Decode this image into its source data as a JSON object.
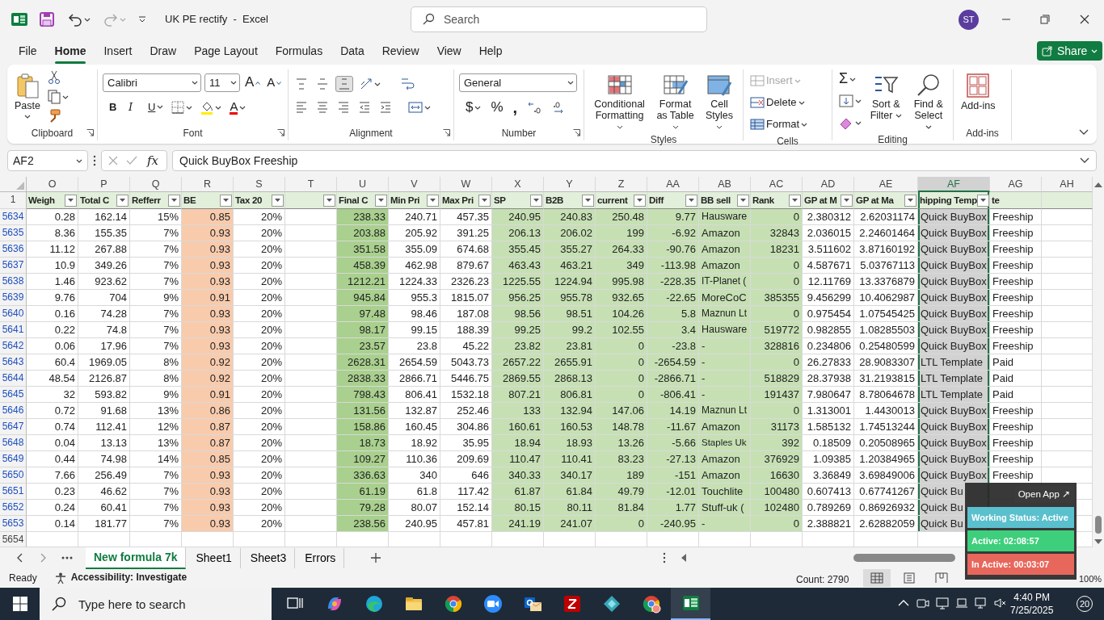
{
  "window": {
    "title": "UK PE rectify  -  Excel",
    "search_placeholder": "Search",
    "avatar": "ST"
  },
  "menu": [
    {
      "label": "File",
      "selected": false
    },
    {
      "label": "Home",
      "selected": true
    },
    {
      "label": "Insert",
      "selected": false
    },
    {
      "label": "Draw",
      "selected": false
    },
    {
      "label": "Page Layout",
      "selected": false
    },
    {
      "label": "Formulas",
      "selected": false
    },
    {
      "label": "Data",
      "selected": false
    },
    {
      "label": "Review",
      "selected": false
    },
    {
      "label": "View",
      "selected": false
    },
    {
      "label": "Help",
      "selected": false
    }
  ],
  "share": "Share",
  "ribbon": {
    "clipboard": {
      "label": "Clipboard",
      "paste": "Paste"
    },
    "font": {
      "label": "Font",
      "face": "Calibri",
      "size": "11",
      "grow": "A",
      "shrink": "A",
      "bold": "B",
      "italic": "I",
      "underline": "U",
      "color_button": "A"
    },
    "alignment": {
      "label": "Alignment",
      "vertical": [
        {
          "kind": "top",
          "selected": false
        },
        {
          "kind": "middle",
          "selected": false
        },
        {
          "kind": "bottom",
          "selected": true
        }
      ],
      "horizontal": [
        {
          "kind": "left",
          "selected": false
        },
        {
          "kind": "center",
          "selected": false
        },
        {
          "kind": "right",
          "selected": false
        }
      ]
    },
    "number": {
      "label": "Number",
      "format": "General",
      "currency": "$",
      "percent": "%",
      "comma": ","
    },
    "styles": {
      "label": "Styles",
      "buttons": [
        {
          "kind": "conditional",
          "label": "Conditional Formatting"
        },
        {
          "kind": "table",
          "label": "Format as Table"
        },
        {
          "kind": "cellstyles",
          "label": "Cell Styles"
        }
      ]
    },
    "cells": {
      "label": "Cells",
      "buttons": [
        {
          "kind": "insert",
          "label": "Insert",
          "disabled": true
        },
        {
          "kind": "delete",
          "label": "Delete",
          "disabled": false
        },
        {
          "kind": "format",
          "label": "Format",
          "disabled": false
        }
      ]
    },
    "editing": {
      "label": "Editing",
      "autosum": "Σ",
      "buttons": [
        {
          "kind": "sort",
          "label": "Sort & Filter"
        },
        {
          "kind": "find",
          "label": "Find & Select"
        }
      ]
    },
    "addins": {
      "label": "Add-ins",
      "button": "Add-ins"
    }
  },
  "formula_bar": {
    "name_box": "AF2",
    "fx": "fx",
    "value": "Quick BuyBox Freeship"
  },
  "columns": [
    {
      "letter": "O",
      "kind": "number",
      "selected": false
    },
    {
      "letter": "P",
      "kind": "number",
      "selected": false
    },
    {
      "letter": "Q",
      "kind": "number",
      "selected": false
    },
    {
      "letter": "R",
      "kind": "number",
      "selected": false,
      "color": "#f8cbad"
    },
    {
      "letter": "S",
      "kind": "number",
      "selected": false
    },
    {
      "letter": "T",
      "kind": "blank",
      "selected": false
    },
    {
      "letter": "U",
      "kind": "number",
      "selected": false,
      "color": "#a9d08e"
    },
    {
      "letter": "V",
      "kind": "number",
      "selected": false
    },
    {
      "letter": "W",
      "kind": "number",
      "selected": false
    },
    {
      "letter": "X",
      "kind": "number",
      "selected": false,
      "color": "#c6e0b4"
    },
    {
      "letter": "Y",
      "kind": "number",
      "selected": false,
      "color": "#c6e0b4"
    },
    {
      "letter": "Z",
      "kind": "number",
      "selected": false,
      "color": "#c6e0b4"
    },
    {
      "letter": "AA",
      "kind": "number",
      "selected": false,
      "color": "#c6e0b4"
    },
    {
      "letter": "AB",
      "kind": "text",
      "selected": false,
      "color": "#c6e0b4"
    },
    {
      "letter": "AC",
      "kind": "number",
      "selected": false,
      "color": "#c6e0b4"
    },
    {
      "letter": "AD",
      "kind": "number",
      "selected": false
    },
    {
      "letter": "AE",
      "kind": "number",
      "selected": false
    },
    {
      "letter": "AF",
      "kind": "text",
      "selected": true
    },
    {
      "letter": "AG",
      "kind": "text",
      "selected": false
    },
    {
      "letter": "AH",
      "kind": "blank",
      "selected": false
    }
  ],
  "header_row": {
    "number": "1",
    "cells": [
      {
        "text": "Weigh",
        "filter": true
      },
      {
        "text": "Total C",
        "filter": true
      },
      {
        "text": "Refferr",
        "filter": true
      },
      {
        "text": "BE",
        "filter": true
      },
      {
        "text": "Tax 20",
        "filter": true
      },
      {
        "filter": true
      },
      {
        "text": "Final C",
        "filter": true
      },
      {
        "text": "Min Pri",
        "filter": true
      },
      {
        "text": "Max Pri",
        "filter": true
      },
      {
        "text": "SP",
        "filter": true
      },
      {
        "text": "B2B",
        "filter": true
      },
      {
        "text": "current",
        "filter": true
      },
      {
        "text": "Diff",
        "filter": true
      },
      {
        "text": "BB sell",
        "filter": true
      },
      {
        "text": "Rank",
        "filter": true
      },
      {
        "text": "GP at M",
        "filter": true
      },
      {
        "text": "GP at Ma",
        "filter": true
      },
      {
        "text": "hipping Temp",
        "filter": true
      },
      {
        "text": "te",
        "filter": false
      },
      {
        "filter": false
      }
    ]
  },
  "rows": [
    {
      "number": "5634",
      "filtered": true,
      "cells": [
        "0.28",
        "162.14",
        "15%",
        "0.85",
        "20%",
        "238.33",
        "240.71",
        "457.35",
        "240.95",
        "240.83",
        "250.48",
        "9.77",
        "Hausware",
        "0",
        "2.380312",
        "2.62031174",
        "Quick BuyBox",
        "Freeship"
      ]
    },
    {
      "number": "5635",
      "filtered": true,
      "cells": [
        "8.36",
        "155.35",
        "7%",
        "0.93",
        "20%",
        "203.88",
        "205.92",
        "391.25",
        "206.13",
        "206.02",
        "199",
        "-6.92",
        "Amazon",
        "32843",
        "2.036015",
        "2.24601464",
        "Quick BuyBox",
        "Freeship"
      ]
    },
    {
      "number": "5636",
      "filtered": true,
      "cells": [
        "11.12",
        "267.88",
        "7%",
        "0.93",
        "20%",
        "351.58",
        "355.09",
        "674.68",
        "355.45",
        "355.27",
        "264.33",
        "-90.76",
        "Amazon",
        "18231",
        "3.511602",
        "3.87160192",
        "Quick BuyBox",
        "Freeship"
      ]
    },
    {
      "number": "5637",
      "filtered": true,
      "cells": [
        "10.9",
        "349.26",
        "7%",
        "0.93",
        "20%",
        "458.39",
        "462.98",
        "879.67",
        "463.43",
        "463.21",
        "349",
        "-113.98",
        "Amazon",
        "0",
        "4.587671",
        "5.03767113",
        "Quick BuyBox",
        "Freeship"
      ]
    },
    {
      "number": "5638",
      "filtered": true,
      "cells": [
        "1.46",
        "923.62",
        "7%",
        "0.93",
        "20%",
        "1212.21",
        "1224.33",
        "2326.23",
        "1225.55",
        "1224.94",
        "995.98",
        "-228.35",
        "IT-Planet (",
        "0",
        "12.11769",
        "13.3376879",
        "Quick BuyBox",
        "Freeship"
      ]
    },
    {
      "number": "5639",
      "filtered": true,
      "cells": [
        "9.76",
        "704",
        "9%",
        "0.91",
        "20%",
        "945.84",
        "955.3",
        "1815.07",
        "956.25",
        "955.78",
        "932.65",
        "-22.65",
        "MoreCoC",
        "385355",
        "9.456299",
        "10.4062987",
        "Quick BuyBox",
        "Freeship"
      ]
    },
    {
      "number": "5640",
      "filtered": true,
      "cells": [
        "0.16",
        "74.28",
        "7%",
        "0.93",
        "20%",
        "97.48",
        "98.46",
        "187.08",
        "98.56",
        "98.51",
        "104.26",
        "5.8",
        "Maznun Lt",
        "0",
        "0.975454",
        "1.07545425",
        "Quick BuyBox",
        "Freeship"
      ]
    },
    {
      "number": "5641",
      "filtered": true,
      "cells": [
        "0.22",
        "74.8",
        "7%",
        "0.93",
        "20%",
        "98.17",
        "99.15",
        "188.39",
        "99.25",
        "99.2",
        "102.55",
        "3.4",
        "Hausware",
        "519772",
        "0.982855",
        "1.08285503",
        "Quick BuyBox",
        "Freeship"
      ]
    },
    {
      "number": "5642",
      "filtered": true,
      "cells": [
        "0.06",
        "17.96",
        "7%",
        "0.93",
        "20%",
        "23.57",
        "23.8",
        "45.22",
        "23.82",
        "23.81",
        "0",
        "-23.8",
        "-",
        "328816",
        "0.234806",
        "0.25480599",
        "Quick BuyBox",
        "Freeship"
      ]
    },
    {
      "number": "5643",
      "filtered": true,
      "cells": [
        "60.4",
        "1969.05",
        "8%",
        "0.92",
        "20%",
        "2628.31",
        "2654.59",
        "5043.73",
        "2657.22",
        "2655.91",
        "0",
        "-2654.59",
        "-",
        "0",
        "26.27833",
        "28.9083307",
        "LTL Template",
        "Paid"
      ]
    },
    {
      "number": "5644",
      "filtered": true,
      "cells": [
        "48.54",
        "2126.87",
        "8%",
        "0.92",
        "20%",
        "2838.33",
        "2866.71",
        "5446.75",
        "2869.55",
        "2868.13",
        "0",
        "-2866.71",
        "-",
        "518829",
        "28.37938",
        "31.2193815",
        "LTL Template",
        "Paid"
      ]
    },
    {
      "number": "5645",
      "filtered": true,
      "cells": [
        "32",
        "593.82",
        "9%",
        "0.91",
        "20%",
        "798.43",
        "806.41",
        "1532.18",
        "807.21",
        "806.81",
        "0",
        "-806.41",
        "-",
        "191437",
        "7.980647",
        "8.78064678",
        "LTL Template",
        "Paid"
      ]
    },
    {
      "number": "5646",
      "filtered": true,
      "cells": [
        "0.72",
        "91.68",
        "13%",
        "0.86",
        "20%",
        "131.56",
        "132.87",
        "252.46",
        "133",
        "132.94",
        "147.06",
        "14.19",
        "Maznun Lt",
        "0",
        "1.313001",
        "1.4430013",
        "Quick BuyBox",
        "Freeship"
      ]
    },
    {
      "number": "5647",
      "filtered": true,
      "cells": [
        "0.74",
        "112.41",
        "12%",
        "0.87",
        "20%",
        "158.86",
        "160.45",
        "304.86",
        "160.61",
        "160.53",
        "148.78",
        "-11.67",
        "Amazon",
        "31173",
        "1.585132",
        "1.74513244",
        "Quick BuyBox",
        "Freeship"
      ]
    },
    {
      "number": "5648",
      "filtered": true,
      "cells": [
        "0.04",
        "13.13",
        "13%",
        "0.87",
        "20%",
        "18.73",
        "18.92",
        "35.95",
        "18.94",
        "18.93",
        "13.26",
        "-5.66",
        "Staples Uk",
        "392",
        "0.18509",
        "0.20508965",
        "Quick BuyBox",
        "Freeship"
      ]
    },
    {
      "number": "5649",
      "filtered": true,
      "cells": [
        "0.44",
        "74.98",
        "14%",
        "0.85",
        "20%",
        "109.27",
        "110.36",
        "209.69",
        "110.47",
        "110.41",
        "83.23",
        "-27.13",
        "Amazon",
        "376929",
        "1.09385",
        "1.20384965",
        "Quick BuyBox",
        "Freeship"
      ]
    },
    {
      "number": "5650",
      "filtered": true,
      "cells": [
        "7.66",
        "256.49",
        "7%",
        "0.93",
        "20%",
        "336.63",
        "340",
        "646",
        "340.33",
        "340.17",
        "189",
        "-151",
        "Amazon",
        "16630",
        "3.36849",
        "3.69849006",
        "Quick BuyBox",
        "Freeship"
      ]
    },
    {
      "number": "5651",
      "filtered": true,
      "cells": [
        "0.23",
        "46.62",
        "7%",
        "0.93",
        "20%",
        "61.19",
        "61.8",
        "117.42",
        "61.87",
        "61.84",
        "49.79",
        "-12.01",
        "Touchlite",
        "100480",
        "0.607413",
        "0.67741267",
        "Quick Bu"
      ]
    },
    {
      "number": "5652",
      "filtered": true,
      "cells": [
        "0.24",
        "60.41",
        "7%",
        "0.93",
        "20%",
        "79.28",
        "80.07",
        "152.14",
        "80.15",
        "80.11",
        "81.84",
        "1.77",
        "Stuff-uk (",
        "102480",
        "0.789269",
        "0.86926932",
        "Quick Bu"
      ]
    },
    {
      "number": "5653",
      "filtered": true,
      "cells": [
        "0.14",
        "181.77",
        "7%",
        "0.93",
        "20%",
        "238.56",
        "240.95",
        "457.81",
        "241.19",
        "241.07",
        "0",
        "-240.95",
        "-",
        "0",
        "2.388821",
        "2.62882059",
        "Quick Bu"
      ]
    }
  ],
  "empty_row": {
    "number": "5654"
  },
  "sheet_tabs": [
    {
      "label": "New formula 7k",
      "selected": true
    },
    {
      "label": "Sheet1",
      "selected": false
    },
    {
      "label": "Sheet3",
      "selected": false
    },
    {
      "label": "Errors",
      "selected": false
    }
  ],
  "status_bar": {
    "mode": "Ready",
    "accessibility": "Accessibility: Investigate",
    "count": "Count: 2790",
    "views": [
      {
        "kind": "normal",
        "selected": true
      },
      {
        "kind": "layout",
        "selected": false
      },
      {
        "kind": "pagebreak",
        "selected": false
      }
    ],
    "zoom": "100%"
  },
  "tracker": {
    "open_app": "Open App ↗",
    "statuses": [
      {
        "text": "Working Status: Active",
        "color": "#5bc0cd"
      },
      {
        "text": "Active: 02:08:57",
        "color": "#3ecf7c"
      },
      {
        "text": "In Active: 00:03:07",
        "color": "#e8675c"
      }
    ]
  },
  "taskbar": {
    "search_placeholder": "Type here to search",
    "apps": [
      {
        "kind": "taskview",
        "active": false
      },
      {
        "kind": "copilot",
        "active": false
      },
      {
        "kind": "edge",
        "active": false
      },
      {
        "kind": "explorer",
        "active": false
      },
      {
        "kind": "chrome",
        "active": false
      },
      {
        "kind": "zoom",
        "active": false
      },
      {
        "kind": "outlook",
        "active": false
      },
      {
        "kind": "filezilla",
        "active": false
      },
      {
        "kind": "diamond",
        "active": false
      },
      {
        "kind": "chrome2",
        "active": false
      },
      {
        "kind": "excel",
        "active": true
      }
    ],
    "time": "4:40 PM",
    "date": "7/25/2025",
    "notifications": "20"
  }
}
